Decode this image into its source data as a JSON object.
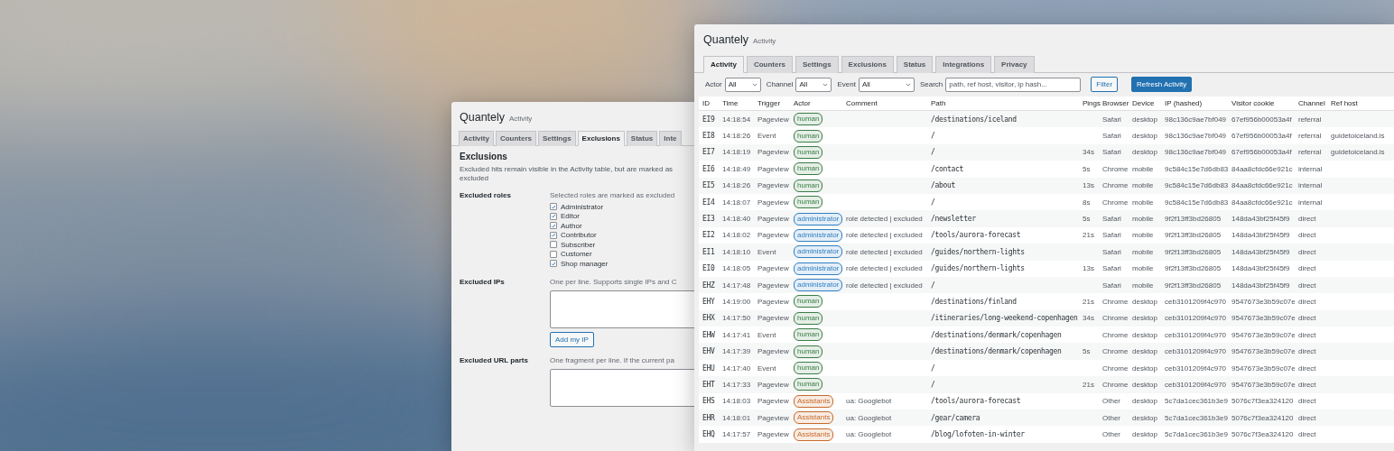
{
  "settings_window": {
    "title": "Quantely",
    "subtitle": "Activity",
    "tabs": [
      {
        "label": "Activity",
        "selected": false
      },
      {
        "label": "Counters",
        "selected": false
      },
      {
        "label": "Settings",
        "selected": false
      },
      {
        "label": "Exclusions",
        "selected": true
      },
      {
        "label": "Status",
        "selected": false
      },
      {
        "label": "Inte",
        "selected": false
      }
    ],
    "heading": "Exclusions",
    "description": "Excluded hits remain visible in the Activity table, but are marked as excluded",
    "sections": [
      {
        "kind": "checklist",
        "label": "Excluded roles",
        "hint": "Selected roles are marked as excluded",
        "options": [
          {
            "label": "Administrator",
            "checked": true
          },
          {
            "label": "Editor",
            "checked": true
          },
          {
            "label": "Author",
            "checked": true
          },
          {
            "label": "Contributor",
            "checked": true
          },
          {
            "label": "Subscriber",
            "checked": false
          },
          {
            "label": "Customer",
            "checked": false
          },
          {
            "label": "Shop manager",
            "checked": true
          }
        ]
      },
      {
        "kind": "textarea",
        "label": "Excluded IPs",
        "hint": "One per line. Supports single IPs and C",
        "button": "Add my IP"
      },
      {
        "kind": "textarea",
        "label": "Excluded URL parts",
        "hint": "One fragment per line. If the current pa"
      }
    ]
  },
  "activity_window": {
    "title": "Quantely",
    "subtitle": "Activity",
    "tabs": [
      {
        "label": "Activity",
        "selected": true
      },
      {
        "label": "Counters",
        "selected": false
      },
      {
        "label": "Settings",
        "selected": false
      },
      {
        "label": "Exclusions",
        "selected": false
      },
      {
        "label": "Status",
        "selected": false
      },
      {
        "label": "Integrations",
        "selected": false
      },
      {
        "label": "Privacy",
        "selected": false
      }
    ],
    "filters": [
      {
        "label": "Actor",
        "value": "All"
      },
      {
        "label": "Channel",
        "value": "All"
      },
      {
        "label": "Event",
        "value": "All"
      }
    ],
    "search": {
      "label": "Search",
      "placeholder": "path, ref host, visitor, ip hash..."
    },
    "buttons": [
      {
        "label": "Filter",
        "primary": false
      },
      {
        "label": "Refresh Activity",
        "primary": true
      }
    ],
    "table": {
      "columns": [
        "ID",
        "Time",
        "Trigger",
        "Actor",
        "Comment",
        "Path",
        "Pings",
        "Browser",
        "Device",
        "IP (hashed)",
        "Visitor cookie",
        "Channel",
        "Ref host"
      ],
      "rows": [
        {
          "id": "EI9",
          "time": "14:18:54",
          "trigger": "Pageview",
          "actor": {
            "label": "human",
            "color": "#3a7d44"
          },
          "path": "/destinations/iceland",
          "browser": "Safari",
          "device": "desktop",
          "ip": "98c136c9ae7bf049",
          "visitor": "67ef956b00053a4f",
          "channel": "referral"
        },
        {
          "id": "EI8",
          "time": "14:18:26",
          "trigger": "Event",
          "actor": {
            "label": "human",
            "color": "#3a7d44"
          },
          "path": "/",
          "browser": "Safari",
          "device": "desktop",
          "ip": "98c136c9ae7bf049",
          "visitor": "67ef956b00053a4f",
          "channel": "referral",
          "ref_host": "guidetoiceland.is"
        },
        {
          "id": "EI7",
          "time": "14:18:19",
          "trigger": "Pageview",
          "actor": {
            "label": "human",
            "color": "#3a7d44"
          },
          "path": "/",
          "pings": "34s",
          "browser": "Safari",
          "device": "desktop",
          "ip": "98c136c9ae7bf049",
          "visitor": "67ef956b00053a4f",
          "channel": "referral",
          "ref_host": "guidetoiceland.is"
        },
        {
          "id": "EI6",
          "time": "14:18:49",
          "trigger": "Pageview",
          "actor": {
            "label": "human",
            "color": "#3a7d44"
          },
          "path": "/contact",
          "pings": "5s",
          "browser": "Chrome",
          "device": "mobile",
          "ip": "9c584c15e7d6db83",
          "visitor": "84aa8cfdc66e921c",
          "channel": "internal"
        },
        {
          "id": "EI5",
          "time": "14:18:26",
          "trigger": "Pageview",
          "actor": {
            "label": "human",
            "color": "#3a7d44"
          },
          "path": "/about",
          "pings": "13s",
          "browser": "Chrome",
          "device": "mobile",
          "ip": "9c584c15e7d6db83",
          "visitor": "84aa8cfdc66e921c",
          "channel": "internal"
        },
        {
          "id": "EI4",
          "time": "14:18:07",
          "trigger": "Pageview",
          "actor": {
            "label": "human",
            "color": "#3a7d44"
          },
          "path": "/",
          "pings": "8s",
          "browser": "Chrome",
          "device": "mobile",
          "ip": "9c584c15e7d6db83",
          "visitor": "84aa8cfdc66e921c",
          "channel": "internal"
        },
        {
          "id": "EI3",
          "time": "14:18:40",
          "trigger": "Pageview",
          "actor": {
            "label": "administrator",
            "color": "#2f7fc1"
          },
          "comment": "role detected | excluded",
          "path": "/newsletter",
          "pings": "5s",
          "browser": "Safari",
          "device": "mobile",
          "ip": "9f2f13ff3bd26805",
          "visitor": "148da43bf25f45f9",
          "channel": "direct"
        },
        {
          "id": "EI2",
          "time": "14:18:02",
          "trigger": "Pageview",
          "actor": {
            "label": "administrator",
            "color": "#2f7fc1"
          },
          "comment": "role detected | excluded",
          "path": "/tools/aurora-forecast",
          "pings": "21s",
          "browser": "Safari",
          "device": "mobile",
          "ip": "9f2f13ff3bd26805",
          "visitor": "148da43bf25f45f9",
          "channel": "direct"
        },
        {
          "id": "EI1",
          "time": "14:18:10",
          "trigger": "Event",
          "actor": {
            "label": "administrator",
            "color": "#2f7fc1"
          },
          "comment": "role detected | excluded",
          "path": "/guides/northern-lights",
          "browser": "Safari",
          "device": "mobile",
          "ip": "9f2f13ff3bd26805",
          "visitor": "148da43bf25f45f9",
          "channel": "direct"
        },
        {
          "id": "EI0",
          "time": "14:18:05",
          "trigger": "Pageview",
          "actor": {
            "label": "administrator",
            "color": "#2f7fc1"
          },
          "comment": "role detected | excluded",
          "path": "/guides/northern-lights",
          "pings": "13s",
          "browser": "Safari",
          "device": "mobile",
          "ip": "9f2f13ff3bd26805",
          "visitor": "148da43bf25f45f9",
          "channel": "direct"
        },
        {
          "id": "EHZ",
          "time": "14:17:48",
          "trigger": "Pageview",
          "actor": {
            "label": "administrator",
            "color": "#2f7fc1"
          },
          "comment": "role detected | excluded",
          "path": "/",
          "browser": "Safari",
          "device": "mobile",
          "ip": "9f2f13ff3bd26805",
          "visitor": "148da43bf25f45f9",
          "channel": "direct"
        },
        {
          "id": "EHY",
          "time": "14:19:00",
          "trigger": "Pageview",
          "actor": {
            "label": "human",
            "color": "#3a7d44"
          },
          "path": "/destinations/finland",
          "pings": "21s",
          "browser": "Chrome",
          "device": "desktop",
          "ip": "ceb3101209f4c970",
          "visitor": "9547673e3b59c07e",
          "channel": "direct"
        },
        {
          "id": "EHX",
          "time": "14:17:50",
          "trigger": "Pageview",
          "actor": {
            "label": "human",
            "color": "#3a7d44"
          },
          "path": "/itineraries/long-weekend-copenhagen",
          "pings": "34s",
          "browser": "Chrome",
          "device": "desktop",
          "ip": "ceb3101209f4c970",
          "visitor": "9547673e3b59c07e",
          "channel": "direct"
        },
        {
          "id": "EHW",
          "time": "14:17:41",
          "trigger": "Event",
          "actor": {
            "label": "human",
            "color": "#3a7d44"
          },
          "path": "/destinations/denmark/copenhagen",
          "browser": "Chrome",
          "device": "desktop",
          "ip": "ceb3101209f4c970",
          "visitor": "9547673e3b59c07e",
          "channel": "direct"
        },
        {
          "id": "EHV",
          "time": "14:17:39",
          "trigger": "Pageview",
          "actor": {
            "label": "human",
            "color": "#3a7d44"
          },
          "path": "/destinations/denmark/copenhagen",
          "pings": "5s",
          "browser": "Chrome",
          "device": "desktop",
          "ip": "ceb3101209f4c970",
          "visitor": "9547673e3b59c07e",
          "channel": "direct"
        },
        {
          "id": "EHU",
          "time": "14:17:40",
          "trigger": "Event",
          "actor": {
            "label": "human",
            "color": "#3a7d44"
          },
          "path": "/",
          "browser": "Chrome",
          "device": "desktop",
          "ip": "ceb3101209f4c970",
          "visitor": "9547673e3b59c07e",
          "channel": "direct"
        },
        {
          "id": "EHT",
          "time": "14:17:33",
          "trigger": "Pageview",
          "actor": {
            "label": "human",
            "color": "#3a7d44"
          },
          "path": "/",
          "pings": "21s",
          "browser": "Chrome",
          "device": "desktop",
          "ip": "ceb3101209f4c970",
          "visitor": "9547673e3b59c07e",
          "channel": "direct"
        },
        {
          "id": "EHS",
          "time": "14:18:03",
          "trigger": "Pageview",
          "actor": {
            "label": "Assistants",
            "color": "#c8692a"
          },
          "comment": "ua: Googlebot",
          "path": "/tools/aurora-forecast",
          "browser": "Other",
          "device": "desktop",
          "ip": "5c7da1cec361b3e9",
          "visitor": "5076c7f3ea324120",
          "channel": "direct"
        },
        {
          "id": "EHR",
          "time": "14:18:01",
          "trigger": "Pageview",
          "actor": {
            "label": "Assistants",
            "color": "#c8692a"
          },
          "comment": "ua: Googlebot",
          "path": "/gear/camera",
          "browser": "Other",
          "device": "desktop",
          "ip": "5c7da1cec361b3e9",
          "visitor": "5076c7f3ea324120",
          "channel": "direct"
        },
        {
          "id": "EHQ",
          "time": "14:17:57",
          "trigger": "Pageview",
          "actor": {
            "label": "Assistants",
            "color": "#c8692a"
          },
          "comment": "ua: Googlebot",
          "path": "/blog/lofoten-in-winter",
          "browser": "Other",
          "device": "desktop",
          "ip": "5c7da1cec361b3e9",
          "visitor": "5076c7f3ea324120",
          "channel": "direct"
        }
      ]
    }
  }
}
